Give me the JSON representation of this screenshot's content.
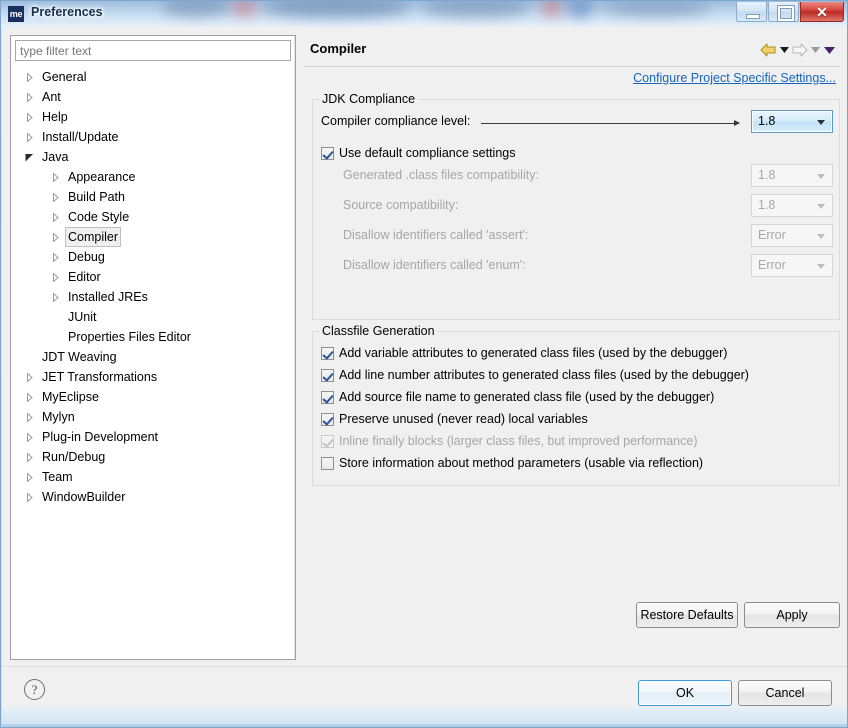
{
  "window": {
    "title": "Preferences",
    "icon_label": "me",
    "icon_name": "myeclipse-icon",
    "controls": {
      "minimize": "minimize-icon",
      "maximize": "restore-icon",
      "close": "✕"
    }
  },
  "sidebar": {
    "filter": {
      "placeholder": "type filter text",
      "value": ""
    },
    "items": [
      {
        "label": "General",
        "level": 0,
        "state": "collapsed",
        "selected": false
      },
      {
        "label": "Ant",
        "level": 0,
        "state": "collapsed",
        "selected": false
      },
      {
        "label": "Help",
        "level": 0,
        "state": "collapsed",
        "selected": false
      },
      {
        "label": "Install/Update",
        "level": 0,
        "state": "collapsed",
        "selected": false
      },
      {
        "label": "Java",
        "level": 0,
        "state": "expanded",
        "selected": false
      },
      {
        "label": "Appearance",
        "level": 1,
        "state": "collapsed",
        "selected": false
      },
      {
        "label": "Build Path",
        "level": 1,
        "state": "collapsed",
        "selected": false
      },
      {
        "label": "Code Style",
        "level": 1,
        "state": "collapsed",
        "selected": false
      },
      {
        "label": "Compiler",
        "level": 1,
        "state": "collapsed",
        "selected": true
      },
      {
        "label": "Debug",
        "level": 1,
        "state": "collapsed",
        "selected": false
      },
      {
        "label": "Editor",
        "level": 1,
        "state": "collapsed",
        "selected": false
      },
      {
        "label": "Installed JREs",
        "level": 1,
        "state": "collapsed",
        "selected": false
      },
      {
        "label": "JUnit",
        "level": 1,
        "state": "leaf",
        "selected": false
      },
      {
        "label": "Properties Files Editor",
        "level": 1,
        "state": "leaf",
        "selected": false
      },
      {
        "label": "JDT Weaving",
        "level": 0,
        "state": "leaf",
        "selected": false
      },
      {
        "label": "JET Transformations",
        "level": 0,
        "state": "collapsed",
        "selected": false
      },
      {
        "label": "MyEclipse",
        "level": 0,
        "state": "collapsed",
        "selected": false
      },
      {
        "label": "Mylyn",
        "level": 0,
        "state": "collapsed",
        "selected": false
      },
      {
        "label": "Plug-in Development",
        "level": 0,
        "state": "collapsed",
        "selected": false
      },
      {
        "label": "Run/Debug",
        "level": 0,
        "state": "collapsed",
        "selected": false
      },
      {
        "label": "Team",
        "level": 0,
        "state": "collapsed",
        "selected": false
      },
      {
        "label": "WindowBuilder",
        "level": 0,
        "state": "collapsed",
        "selected": false
      }
    ]
  },
  "content": {
    "title": "Compiler",
    "nav": {
      "back_icon": "back-arrow-icon",
      "back_menu_icon": "chevron-down-icon",
      "forward_icon": "forward-arrow-icon",
      "forward_menu_icon": "chevron-down-icon",
      "page_menu_icon": "chevron-down-icon"
    },
    "configure_link": "Configure Project Specific Settings...",
    "groups": [
      {
        "title": "JDK Compliance",
        "rows": [
          {
            "label": "Compiler compliance level:",
            "value": "1.8",
            "disabled": false,
            "focused": true,
            "connector": true
          },
          {
            "label": "Generated .class files compatibility:",
            "value": "1.8",
            "disabled": true,
            "focused": false,
            "connector": false
          },
          {
            "label": "Source compatibility:",
            "value": "1.8",
            "disabled": true,
            "focused": false,
            "connector": false
          },
          {
            "label": "Disallow identifiers called 'assert':",
            "value": "Error",
            "disabled": true,
            "focused": false,
            "connector": false
          },
          {
            "label": "Disallow identifiers called 'enum':",
            "value": "Error",
            "disabled": true,
            "focused": false,
            "connector": false
          }
        ],
        "checkbox": {
          "label": "Use default compliance settings",
          "checked": true,
          "disabled": false
        }
      },
      {
        "title": "Classfile Generation",
        "checkboxes": [
          {
            "label": "Add variable attributes to generated class files (used by the debugger)",
            "checked": true,
            "disabled": false
          },
          {
            "label": "Add line number attributes to generated class files (used by the debugger)",
            "checked": true,
            "disabled": false
          },
          {
            "label": "Add source file name to generated class file (used by the debugger)",
            "checked": true,
            "disabled": false
          },
          {
            "label": "Preserve unused (never read) local variables",
            "checked": true,
            "disabled": false
          },
          {
            "label": "Inline finally blocks (larger class files, but improved performance)",
            "checked": true,
            "disabled": true
          },
          {
            "label": "Store information about method parameters (usable via reflection)",
            "checked": false,
            "disabled": false
          }
        ]
      }
    ],
    "buttons": {
      "restore_defaults": "Restore Defaults",
      "apply": "Apply"
    }
  },
  "footer": {
    "help_icon": "?",
    "ok": "OK",
    "cancel": "Cancel"
  },
  "colors": {
    "link": "#1565c0",
    "accent": "#3c9ad9",
    "panel_bg": "#f0f0f0",
    "tree_bg": "#ffffff",
    "close_button": "#c4342c",
    "back_arrow": "#e8c14a"
  }
}
